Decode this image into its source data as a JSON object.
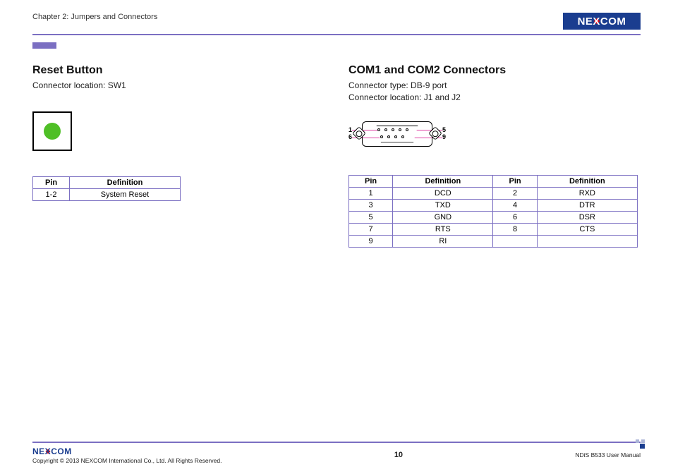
{
  "header": {
    "chapter": "Chapter 2: Jumpers and Connectors",
    "brand": "NEXCOM"
  },
  "left": {
    "title": "Reset Button",
    "sub1": "Connector location: SW1",
    "table": {
      "headers": [
        "Pin",
        "Definition"
      ],
      "rows": [
        [
          "1-2",
          "System Reset"
        ]
      ]
    }
  },
  "right": {
    "title": "COM1 and COM2 Connectors",
    "sub1": "Connector type: DB-9 port",
    "sub2": "Connector location: J1 and J2",
    "labels": {
      "tl": "1",
      "bl": "6",
      "tr": "5",
      "br": "9"
    },
    "table": {
      "headers": [
        "Pin",
        "Definition",
        "Pin",
        "Definition"
      ],
      "rows": [
        [
          "1",
          "DCD",
          "2",
          "RXD"
        ],
        [
          "3",
          "TXD",
          "4",
          "DTR"
        ],
        [
          "5",
          "GND",
          "6",
          "DSR"
        ],
        [
          "7",
          "RTS",
          "8",
          "CTS"
        ],
        [
          "9",
          "RI",
          "",
          ""
        ]
      ]
    }
  },
  "footer": {
    "copyright": "Copyright © 2013 NEXCOM International Co., Ltd. All Rights Reserved.",
    "page": "10",
    "manual": "NDiS B533 User Manual"
  }
}
